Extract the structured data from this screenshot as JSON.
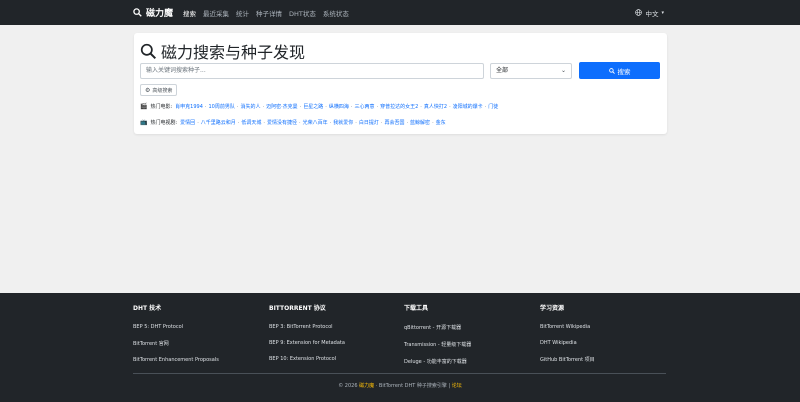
{
  "navbar": {
    "brand": "磁力魔",
    "links": [
      {
        "label": "搜索",
        "active": true
      },
      {
        "label": "最近采集",
        "active": false
      },
      {
        "label": "统计",
        "active": false
      },
      {
        "label": "种子详情",
        "active": false
      },
      {
        "label": "DHT状态",
        "active": false
      },
      {
        "label": "系统状态",
        "active": false
      }
    ],
    "language": "中文"
  },
  "search": {
    "title": "磁力搜索与种子发现",
    "placeholder": "输入关键词搜索种子...",
    "category_selected": "全部",
    "button_label": "搜索",
    "advanced_label": "高级搜索"
  },
  "hot_movies": {
    "label": "热门电影:",
    "items": [
      "肖申克1994",
      "10周前男队",
      "消失的人",
      "迈阿密·杰克曼",
      "巨星之路",
      "纵横四海",
      "三心两意",
      "穿普拉达的女王2",
      "真人快打2",
      "凌阳城的爆卡",
      "门徒"
    ]
  },
  "hot_tv": {
    "label": "热门电视剧:",
    "items": [
      "爱情回",
      "八千里路云和月",
      "低调天城",
      "爱情没有捷径",
      "光荣八百年",
      "我就爱你",
      "白日提灯",
      "再会吾国",
      "蓝鲸解密",
      "金东"
    ]
  },
  "footer": {
    "columns": [
      {
        "title": "DHT 技术",
        "links": [
          "BEP 5: DHT Protocol",
          "BitTorrent 官网",
          "BitTorrent Enhancement Proposals"
        ]
      },
      {
        "title": "BITTORRENT 协议",
        "links": [
          "BEP 3: BitTorrent Protocol",
          "BEP 9: Extension for Metadata",
          "BEP 10: Extension Protocol"
        ]
      },
      {
        "title": "下载工具",
        "links": [
          "qBittorrent - 开源下载器",
          "Transmission - 轻量级下载器",
          "Deluge - 功能丰富的下载器"
        ]
      },
      {
        "title": "学习资源",
        "links": [
          "BitTorrent Wikipedia",
          "DHT Wikipedia",
          "GitHub BitTorrent 项目"
        ]
      }
    ],
    "copyright_prefix": "© 2026",
    "copyright_brand": "磁力魔",
    "copyright_middle": "· BitTorrent DHT 种子搜索引擎 |",
    "copyright_link": "论坛"
  },
  "colors": {
    "navbar_bg": "#212529",
    "primary": "#0d6efd",
    "footer_accent": "#ffc107"
  }
}
